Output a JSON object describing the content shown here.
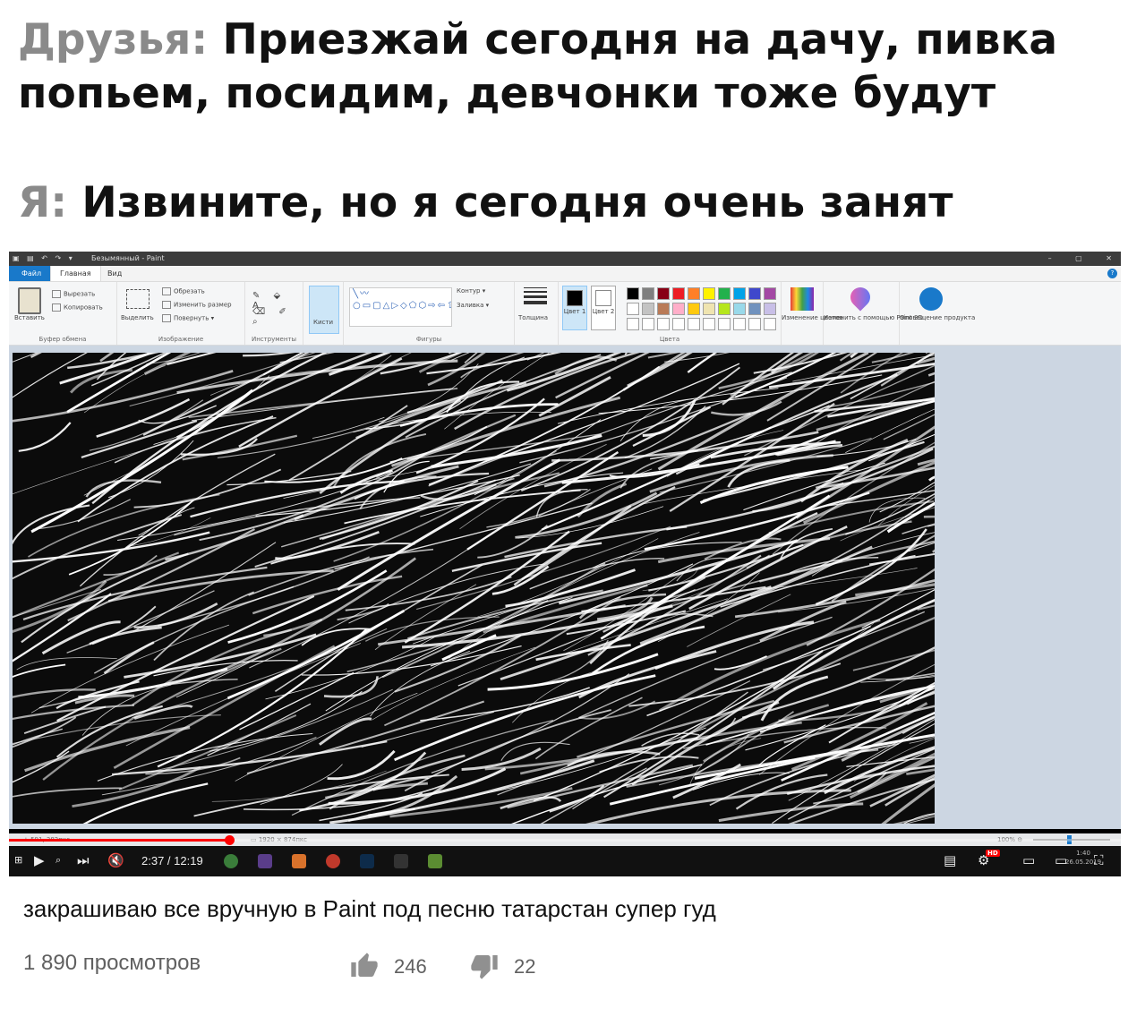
{
  "meme": {
    "line1_speaker": "Друзья:",
    "line1_text": " Приезжай сегодня на дачу, пивка",
    "line2_text": "попьем, посидим, девчонки тоже будут",
    "line3_speaker": "Я:",
    "line3_text": " Извините, но я сегодня очень занят"
  },
  "paint": {
    "window_title": "Безымянный - Paint",
    "window_controls": "–  ▢  ✕",
    "menu": {
      "file": "Файл",
      "home": "Главная",
      "view": "Вид",
      "help": "?"
    },
    "clipboard": {
      "paste": "Вставить",
      "cut": "Вырезать",
      "copy": "Копировать",
      "group": "Буфер обмена"
    },
    "image": {
      "select": "Выделить",
      "crop": "Обрезать",
      "resize": "Изменить размер",
      "rotate": "Повернуть ▾",
      "group": "Изображение"
    },
    "tools": {
      "group": "Инструменты",
      "row1": "✎ ⬙ A",
      "row2": "⌫ ✐ ⌕",
      "brushes": "Кисти"
    },
    "shapes": {
      "group": "Фигуры",
      "outline": "Контур ▾",
      "fill": "Заливка ▾",
      "glyphs": "╲〰○▭▢△▷◇⬠⬡⇨⇦⇧⇩✧☆✡▭◯♡"
    },
    "size": {
      "label": "Толщина"
    },
    "colors": {
      "color1": "Цвет 1",
      "color2": "Цвет 2",
      "group": "Цвета",
      "edit": "Изменение цветов",
      "color1_value": "#000000",
      "color2_value": "#ffffff",
      "palette_row1": [
        "#000000",
        "#7f7f7f",
        "#880015",
        "#ed1c24",
        "#ff7f27",
        "#fff200",
        "#22b14c",
        "#00a2e8",
        "#3f48cc",
        "#a349a4"
      ],
      "palette_row2": [
        "#ffffff",
        "#c3c3c3",
        "#b97a57",
        "#ffaec9",
        "#ffc90e",
        "#efe4b0",
        "#b5e61d",
        "#99d9ea",
        "#7092be",
        "#c8bfe7"
      ]
    },
    "paint3d": {
      "label": "Изменить с помощью Paint 3D"
    },
    "notify": {
      "label": "Оповещение продукта"
    },
    "status": {
      "coords": "+ 591, 382пкс",
      "size": "▭ 1920 × 874пкс",
      "zoom": "100%  ⊖"
    }
  },
  "player": {
    "progress": 0.198,
    "time_current": "2:37",
    "time_total": "12:19",
    "time_separator": " / ",
    "hd_badge": "HD",
    "tray_time": "1:40",
    "tray_date": "26.05.2019"
  },
  "video": {
    "title": "закрашиваю все вручную в Paint под песню татарстан супер гуд",
    "views": "1 890 просмотров",
    "likes": "246",
    "dislikes": "22"
  }
}
